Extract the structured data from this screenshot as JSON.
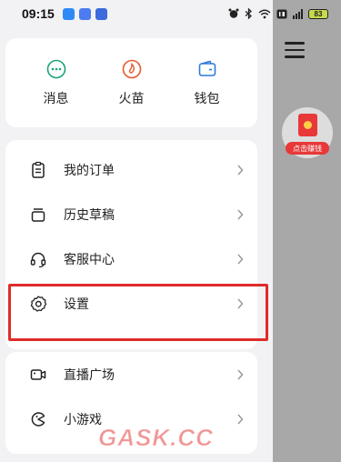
{
  "status_bar": {
    "time": "09:15",
    "battery": "83",
    "icons": [
      "alarm-icon",
      "bluetooth-icon",
      "wifi-icon",
      "hd-icon",
      "signal-icon",
      "battery-icon"
    ]
  },
  "shortcuts": [
    {
      "label": "消息",
      "icon": "message-icon"
    },
    {
      "label": "火苗",
      "icon": "flame-icon"
    },
    {
      "label": "钱包",
      "icon": "wallet-icon"
    }
  ],
  "menu": {
    "group1": [
      {
        "label": "我的订单",
        "icon": "order-icon"
      },
      {
        "label": "历史草稿",
        "icon": "draft-icon"
      },
      {
        "label": "客服中心",
        "icon": "headset-icon"
      },
      {
        "label": "设置",
        "icon": "gear-icon"
      }
    ],
    "group2": [
      {
        "label": "直播广场",
        "icon": "live-camera-icon"
      },
      {
        "label": "小游戏",
        "icon": "game-icon"
      }
    ]
  },
  "widget": {
    "label": "点击赚钱"
  },
  "watermark": "GASK.CC",
  "colors": {
    "accent": "#1aa37a",
    "highlight": "#e02b2b",
    "redpacket": "#e83838"
  }
}
